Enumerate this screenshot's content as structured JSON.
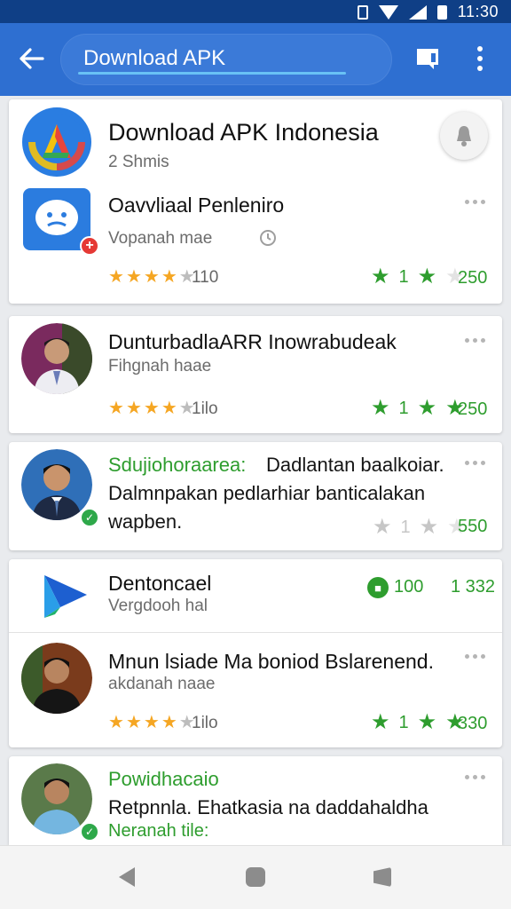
{
  "status_bar": {
    "time": "11:30"
  },
  "appbar": {
    "search_value": "Download APK"
  },
  "cards": [
    {
      "title": "Download APK Indonesia",
      "subtitle": "2 Shmis",
      "app_title": "Oavvliaal Penleniro",
      "app_sub": "Vopanah mae",
      "rating_left_count": "110",
      "rating_right_count": "250",
      "left_stars": 4,
      "right_stars": 2
    },
    {
      "title": "DunturbadlaARR Inowrabudeak",
      "subtitle": "Fihgnah haae",
      "rating_left_count": "1ilo",
      "rating_right_count": "250",
      "left_stars": 4,
      "right_stars": 3
    },
    {
      "title_green": "Sdujiohoraarea:",
      "title_rest": "Dadlantan baalkoiar.",
      "line2": "Dalmnpakan pedlarhiar banticalakan",
      "line3": "wapben.",
      "rating_right_count": "550",
      "right_stars": 0
    },
    {
      "title": "Dentoncael",
      "subtitle": "Vergdooh hal",
      "badge_count": "100",
      "right_count": "1 332",
      "title_2": "Mnun lsiade Ma boniod Bslarenend.",
      "subtitle_2": "akdanah naae",
      "rating_left_count": "1ilo",
      "rating_right_count": "330",
      "left_stars": 4,
      "right_stars": 3
    },
    {
      "title_green": "Powidhacaio",
      "line2": "Retpnnla. Ehatkasia na daddahaldha",
      "line3_green": "Neranah tile:"
    }
  ],
  "icons": {
    "back": "arrow-left-icon",
    "chat": "chat-icon",
    "more": "more-vert-icon",
    "notify": "bell-icon"
  },
  "colors": {
    "status_bar": "#0f3f86",
    "app_bar": "#2e6fd1",
    "accent_green": "#2e9d2e",
    "star_gold": "#f5a623"
  }
}
